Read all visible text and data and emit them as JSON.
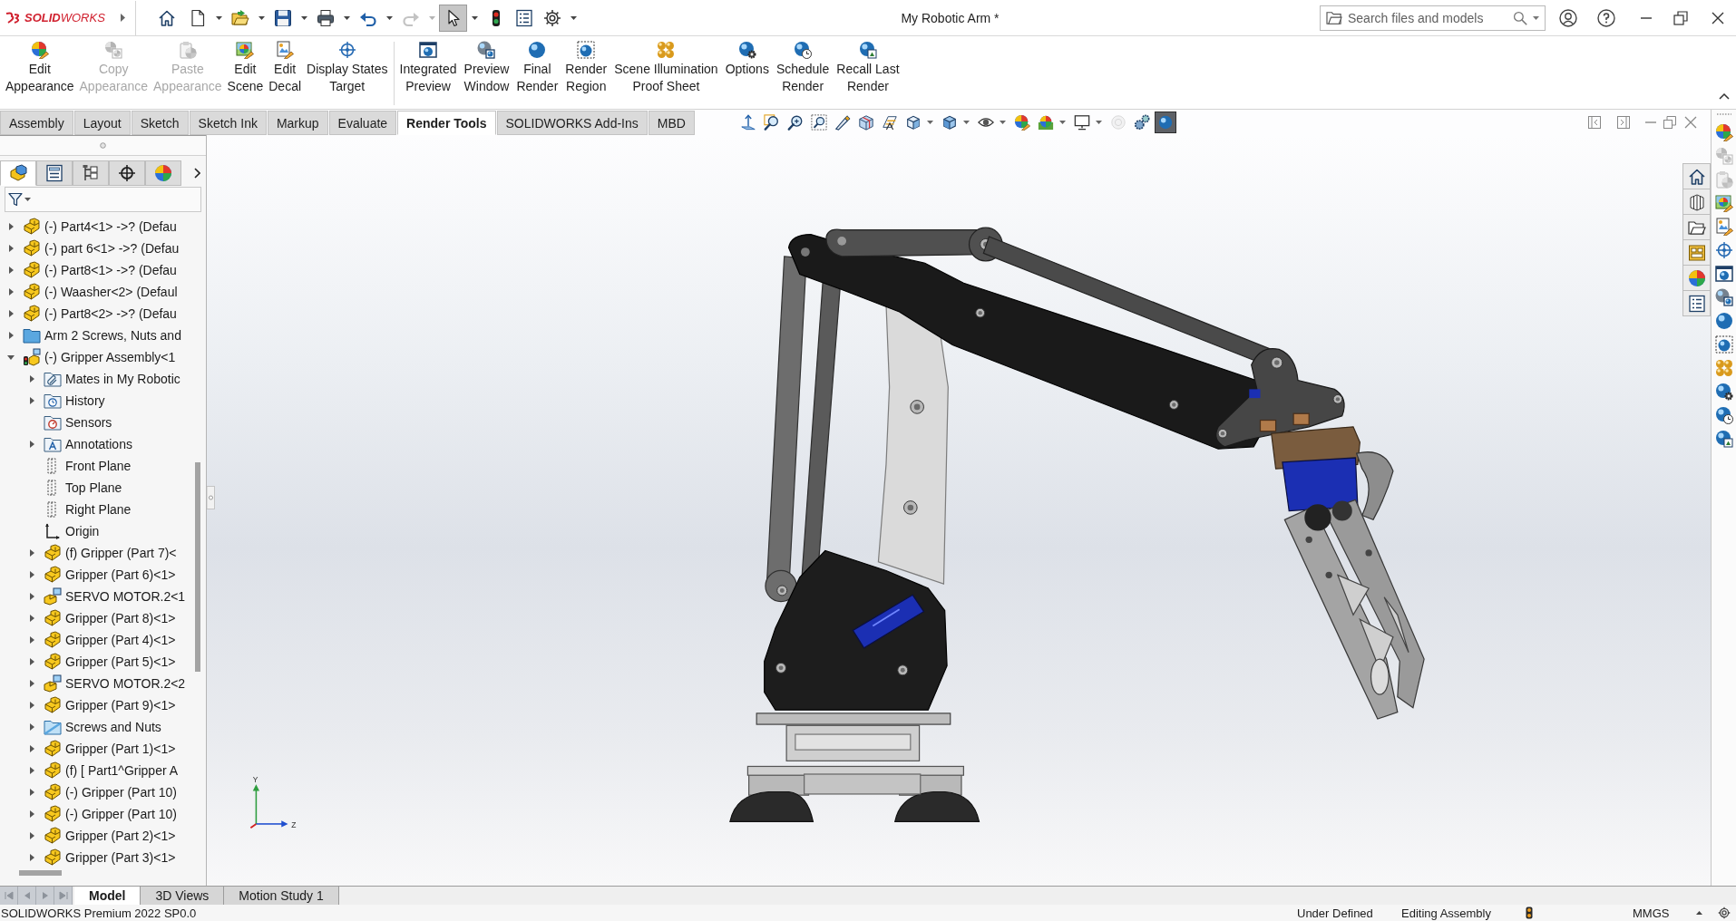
{
  "title_bar": {
    "logo_text": "**SOLID**WORKS",
    "quick_access": [
      {
        "kind": "home",
        "dropdown": false,
        "disabled": false,
        "pressed": false
      },
      {
        "kind": "new",
        "dropdown": true,
        "disabled": false,
        "pressed": false
      },
      {
        "kind": "open",
        "dropdown": true,
        "disabled": false,
        "pressed": false
      },
      {
        "kind": "save",
        "dropdown": true,
        "disabled": false,
        "pressed": false
      },
      {
        "kind": "print",
        "dropdown": true,
        "disabled": false,
        "pressed": false
      },
      {
        "kind": "undo",
        "dropdown": true,
        "disabled": false,
        "pressed": false
      },
      {
        "kind": "redo",
        "dropdown": true,
        "disabled": true,
        "pressed": false
      },
      {
        "kind": "select",
        "dropdown": true,
        "disabled": false,
        "pressed": true
      },
      {
        "kind": "rebuild",
        "dropdown": false,
        "disabled": false,
        "pressed": false
      },
      {
        "kind": "properties",
        "dropdown": false,
        "disabled": false,
        "pressed": false
      },
      {
        "kind": "options",
        "dropdown": true,
        "disabled": false,
        "pressed": false
      }
    ],
    "document_title": "My Robotic Arm *",
    "search": {
      "placeholder": "Search files and models"
    }
  },
  "ribbon": {
    "groups": [
      [
        {
          "kind": "appearance",
          "label": [
            "Edit",
            "Appearance"
          ],
          "disabled": false
        },
        {
          "kind": "copy",
          "label": [
            "Copy",
            "Appearance"
          ],
          "disabled": true
        },
        {
          "kind": "paste",
          "label": [
            "Paste",
            "Appearance"
          ],
          "disabled": true
        },
        {
          "kind": "scene",
          "label": [
            "Edit",
            "Scene"
          ],
          "disabled": false
        },
        {
          "kind": "decal",
          "label": [
            "Edit",
            "Decal"
          ],
          "disabled": false
        },
        {
          "kind": "target",
          "label": [
            "Display States",
            "Target"
          ],
          "disabled": false
        }
      ],
      [
        {
          "kind": "integrated",
          "label": [
            "Integrated",
            "Preview"
          ],
          "disabled": false
        },
        {
          "kind": "preview",
          "label": [
            "Preview",
            "Window"
          ],
          "disabled": false
        },
        {
          "kind": "final",
          "label": [
            "Final",
            "Render"
          ],
          "disabled": false
        },
        {
          "kind": "region",
          "label": [
            "Render",
            "Region"
          ],
          "disabled": false
        },
        {
          "kind": "proof",
          "label": [
            "Scene Illumination",
            "Proof Sheet"
          ],
          "disabled": false
        },
        {
          "kind": "options",
          "label": [
            "Options"
          ],
          "disabled": false
        },
        {
          "kind": "schedule",
          "label": [
            "Schedule",
            "Render"
          ],
          "disabled": false
        },
        {
          "kind": "recall",
          "label": [
            "Recall Last",
            "Render"
          ],
          "disabled": false
        }
      ]
    ]
  },
  "command_tabs": [
    {
      "label": "Assembly",
      "selected": false
    },
    {
      "label": "Layout",
      "selected": false
    },
    {
      "label": "Sketch",
      "selected": false
    },
    {
      "label": "Sketch Ink",
      "selected": false
    },
    {
      "label": "Markup",
      "selected": false
    },
    {
      "label": "Evaluate",
      "selected": false
    },
    {
      "label": "Render Tools",
      "selected": true
    },
    {
      "label": "SOLIDWORKS Add-Ins",
      "selected": false
    },
    {
      "label": "MBD",
      "selected": false
    }
  ],
  "view_toolbar": [
    {
      "kind": "normal",
      "dropdown": false,
      "disabled": false,
      "pressed": false
    },
    {
      "kind": "zoomfit",
      "dropdown": false,
      "disabled": false,
      "pressed": false
    },
    {
      "kind": "zoom",
      "dropdown": false,
      "disabled": false,
      "pressed": false
    },
    {
      "kind": "zoomarea",
      "dropdown": false,
      "disabled": false,
      "pressed": false
    },
    {
      "kind": "previous",
      "dropdown": false,
      "disabled": false,
      "pressed": false
    },
    {
      "kind": "section",
      "dropdown": false,
      "disabled": false,
      "pressed": false
    },
    {
      "kind": "annotation",
      "dropdown": false,
      "disabled": false,
      "pressed": false
    },
    {
      "kind": "orientation",
      "dropdown": true,
      "disabled": false,
      "pressed": false
    },
    {
      "kind": "displaystyle",
      "dropdown": true,
      "disabled": false,
      "pressed": false
    },
    {
      "kind": "visibility",
      "dropdown": true,
      "disabled": false,
      "pressed": false
    },
    {
      "kind": "appearance",
      "dropdown": false,
      "disabled": false,
      "pressed": false
    },
    {
      "kind": "scene",
      "dropdown": true,
      "disabled": false,
      "pressed": false
    },
    {
      "kind": "settings",
      "dropdown": true,
      "disabled": false,
      "pressed": false
    },
    {
      "kind": "realview",
      "dropdown": false,
      "disabled": true,
      "pressed": false
    },
    {
      "kind": "occlusion",
      "dropdown": false,
      "disabled": false,
      "pressed": false
    },
    {
      "kind": "preview",
      "dropdown": false,
      "disabled": false,
      "pressed": true
    }
  ],
  "feature_manager": {
    "panel_tabs": [
      {
        "kind": "features",
        "selected": true
      },
      {
        "kind": "properties",
        "selected": false
      },
      {
        "kind": "configurations",
        "selected": false
      },
      {
        "kind": "dimxpert",
        "selected": false
      },
      {
        "kind": "display",
        "selected": false
      }
    ],
    "tree": [
      {
        "text": "(-) Part4<1> ->? (Defau",
        "kind": "part",
        "expandable": true,
        "expanded": false
      },
      {
        "text": "(-) part 6<1> ->? (Defau",
        "kind": "part",
        "expandable": true,
        "expanded": false
      },
      {
        "text": "(-) Part8<1> ->? (Defau",
        "kind": "part",
        "expandable": true,
        "expanded": false
      },
      {
        "text": "(-) Waasher<2> (Defaul",
        "kind": "part",
        "expandable": true,
        "expanded": false
      },
      {
        "text": "(-) Part8<2> ->? (Defau",
        "kind": "part",
        "expandable": true,
        "expanded": false
      },
      {
        "text": "Arm 2 Screws, Nuts and",
        "kind": "folder",
        "expandable": true,
        "expanded": false
      },
      {
        "text": "(-) Gripper Assembly<1",
        "kind": "assembly",
        "expandable": true,
        "expanded": true,
        "children": [
          {
            "text": "Mates in My Robotic",
            "kind": "mates",
            "expandable": true,
            "expanded": false
          },
          {
            "text": "History",
            "kind": "history",
            "expandable": true,
            "expanded": false
          },
          {
            "text": "Sensors",
            "kind": "sensors",
            "expandable": false,
            "expanded": false
          },
          {
            "text": "Annotations",
            "kind": "annotations",
            "expandable": true,
            "expanded": false
          },
          {
            "text": "Front Plane",
            "kind": "plane",
            "expandable": false,
            "expanded": false
          },
          {
            "text": "Top Plane",
            "kind": "plane",
            "expandable": false,
            "expanded": false
          },
          {
            "text": "Right Plane",
            "kind": "plane",
            "expandable": false,
            "expanded": false
          },
          {
            "text": "Origin",
            "kind": "origin",
            "expandable": false,
            "expanded": false
          },
          {
            "text": "(f) Gripper (Part 7)<",
            "kind": "part",
            "expandable": true,
            "expanded": false
          },
          {
            "text": "Gripper (Part 6)<1>",
            "kind": "part",
            "expandable": true,
            "expanded": false
          },
          {
            "text": "SERVO MOTOR.2<1",
            "kind": "subassembly",
            "expandable": true,
            "expanded": false
          },
          {
            "text": "Gripper (Part 8)<1>",
            "kind": "part",
            "expandable": true,
            "expanded": false
          },
          {
            "text": "Gripper (Part 4)<1>",
            "kind": "part",
            "expandable": true,
            "expanded": false
          },
          {
            "text": "Gripper (Part 5)<1>",
            "kind": "part",
            "expandable": true,
            "expanded": false
          },
          {
            "text": "SERVO MOTOR.2<2",
            "kind": "subassembly",
            "expandable": true,
            "expanded": false
          },
          {
            "text": "Gripper (Part 9)<1>",
            "kind": "part",
            "expandable": true,
            "expanded": false
          },
          {
            "text": "Screws and Nuts",
            "kind": "lightfolder",
            "expandable": true,
            "expanded": false
          },
          {
            "text": "Gripper (Part 1)<1>",
            "kind": "part",
            "expandable": true,
            "expanded": false
          },
          {
            "text": "(f) [ Part1^Gripper A",
            "kind": "part",
            "expandable": true,
            "expanded": false
          },
          {
            "text": "(-) Gripper (Part 10)",
            "kind": "part",
            "expandable": true,
            "expanded": false
          },
          {
            "text": "(-) Gripper (Part 10)",
            "kind": "part",
            "expandable": true,
            "expanded": false
          },
          {
            "text": "Gripper (Part 2)<1>",
            "kind": "part",
            "expandable": true,
            "expanded": false
          },
          {
            "text": "Gripper (Part 3)<1>",
            "kind": "part",
            "expandable": true,
            "expanded": false
          }
        ]
      }
    ]
  },
  "graphics": {
    "axis_labels": [
      "Y",
      "Z"
    ]
  },
  "render_toolbar": [
    {
      "kind": "appearance",
      "disabled": false
    },
    {
      "kind": "copy",
      "disabled": true
    },
    {
      "kind": "paste",
      "disabled": true
    },
    {
      "kind": "scene",
      "disabled": false
    },
    {
      "kind": "decal",
      "disabled": false
    },
    {
      "kind": "target",
      "disabled": false
    },
    {
      "kind": "integrated",
      "disabled": false
    },
    {
      "kind": "preview",
      "disabled": false
    },
    {
      "kind": "final",
      "disabled": false
    },
    {
      "kind": "region",
      "disabled": false
    },
    {
      "kind": "proof",
      "disabled": false
    },
    {
      "kind": "options",
      "disabled": false
    },
    {
      "kind": "schedule",
      "disabled": false
    },
    {
      "kind": "recall",
      "disabled": false
    }
  ],
  "bottom_tabs": [
    {
      "label": "Model",
      "selected": true
    },
    {
      "label": "3D Views",
      "selected": false
    },
    {
      "label": "Motion Study 1",
      "selected": false
    }
  ],
  "status_bar": {
    "product": "SOLIDWORKS Premium 2022 SP0.0",
    "definition": "Under Defined",
    "mode": "Editing Assembly",
    "units": "MMGS"
  }
}
